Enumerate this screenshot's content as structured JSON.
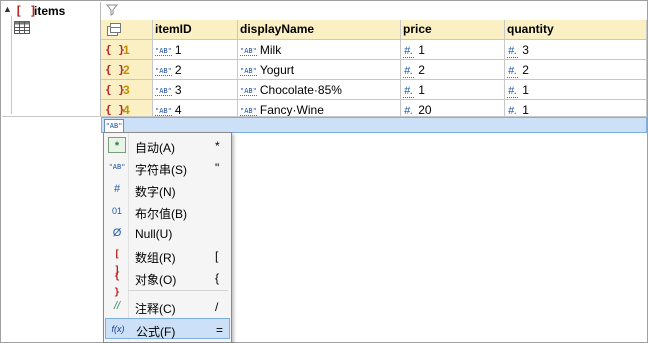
{
  "tree": {
    "bracket": "[ ]",
    "title": "items"
  },
  "table": {
    "columns": [
      "itemID",
      "displayName",
      "price",
      "quantity"
    ],
    "rows": [
      {
        "num": "1",
        "itemID": "1",
        "displayName": "Milk",
        "price": "1",
        "quantity": "3"
      },
      {
        "num": "2",
        "itemID": "2",
        "displayName": "Yogurt",
        "price": "2",
        "quantity": "2"
      },
      {
        "num": "3",
        "itemID": "3",
        "displayName": "Chocolate·85%",
        "price": "1",
        "quantity": "1"
      },
      {
        "num": "4",
        "itemID": "4",
        "displayName": "Fancy·Wine",
        "price": "20",
        "quantity": "1"
      }
    ],
    "row_bracket": "{ }",
    "str_tag": "\"AB\"",
    "num_tag": "#."
  },
  "newrow_tag": "\"AB\"",
  "menu": {
    "items": [
      {
        "icon": "*",
        "label": "自动(A)",
        "shortcut": "*"
      },
      {
        "icon": "\"AB\"",
        "label": "字符串(S)",
        "shortcut": "\""
      },
      {
        "icon": "#",
        "label": "数字(N)",
        "shortcut": ""
      },
      {
        "icon": "01",
        "label": "布尔值(B)",
        "shortcut": ""
      },
      {
        "icon": "Ø",
        "label": "Null(U)",
        "shortcut": ""
      },
      {
        "icon": "[ ]",
        "label": "数组(R)",
        "shortcut": "["
      },
      {
        "icon": "{ }",
        "label": "对象(O)",
        "shortcut": "{"
      },
      {
        "icon": "//",
        "label": "注释(C)",
        "shortcut": "/"
      },
      {
        "icon": "f(x)",
        "label": "公式(F)",
        "shortcut": "="
      }
    ]
  }
}
